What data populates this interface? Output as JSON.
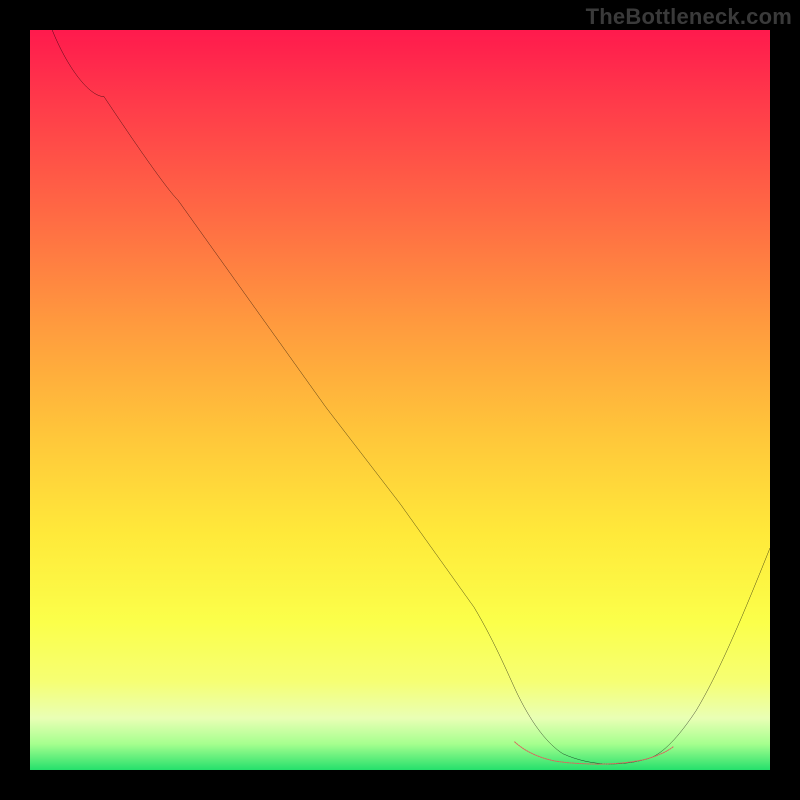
{
  "watermark": "TheBottleneck.com",
  "chart_data": {
    "type": "line",
    "title": "",
    "xlabel": "",
    "ylabel": "",
    "xlim": [
      0,
      100
    ],
    "ylim": [
      0,
      100
    ],
    "gradient_stops": [
      {
        "pos": 0,
        "color": "#ff1a4d"
      },
      {
        "pos": 10,
        "color": "#ff3b4a"
      },
      {
        "pos": 25,
        "color": "#ff6a44"
      },
      {
        "pos": 40,
        "color": "#ff9b3e"
      },
      {
        "pos": 55,
        "color": "#ffc73a"
      },
      {
        "pos": 68,
        "color": "#ffe93a"
      },
      {
        "pos": 80,
        "color": "#fbff4a"
      },
      {
        "pos": 88,
        "color": "#f6ff73"
      },
      {
        "pos": 93,
        "color": "#e9ffb5"
      },
      {
        "pos": 96.5,
        "color": "#a5ff8e"
      },
      {
        "pos": 100,
        "color": "#25e06c"
      }
    ],
    "series": [
      {
        "name": "bottleneck-curve",
        "color": "#000000",
        "x": [
          3,
          6,
          10,
          20,
          30,
          40,
          50,
          60,
          66,
          70,
          74,
          78,
          82,
          86,
          90,
          94,
          100
        ],
        "y": [
          100,
          96,
          91,
          77,
          63,
          49,
          36,
          22,
          12,
          6,
          3,
          1,
          1,
          2,
          6,
          14,
          30
        ]
      },
      {
        "name": "optimal-zone-marker",
        "color": "#d9685f",
        "x": [
          66,
          70,
          74,
          78,
          82,
          86
        ],
        "y": [
          4,
          2,
          1.5,
          1.5,
          2,
          3
        ]
      }
    ],
    "annotations": []
  }
}
